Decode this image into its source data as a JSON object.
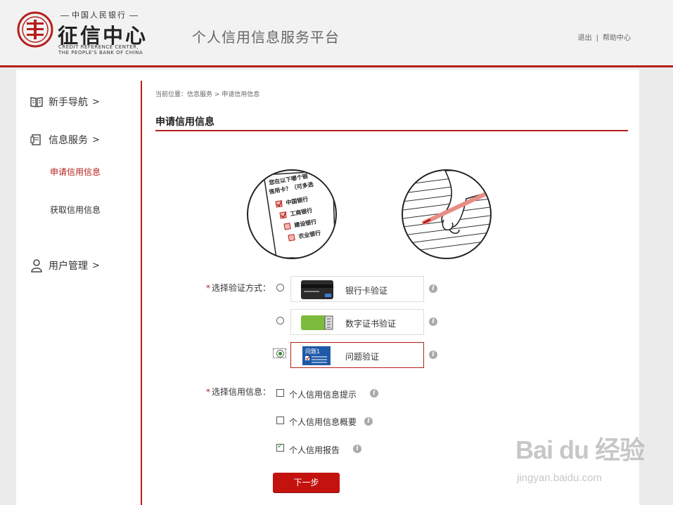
{
  "header": {
    "logo_cn_small": "中国人民银行",
    "logo_cn_big": "征信中心",
    "logo_en_line1": "CREDIT REFERENCE CENTER,",
    "logo_en_line2": "THE PEOPLE'S BANK OF CHINA",
    "platform_title": "个人信用信息服务平台",
    "logout_link": "退出",
    "link_separator": "|",
    "help_link": "帮助中心"
  },
  "sidebar": {
    "nav_guide": "新手导航",
    "nav_info_service": "信息服务",
    "sub_apply": "申请信用信息",
    "sub_get": "获取信用信息",
    "nav_user_mgmt": "用户管理",
    "arrow": ">"
  },
  "main": {
    "breadcrumb": "当前位置：信息服务 > 申请信用信息",
    "page_title": "申请信用信息",
    "illustration": {
      "line1": "您在以下哪个银",
      "line2": "信用卡？（可多选",
      "bank1": "中国银行",
      "bank2": "工商银行",
      "bank3": "建设银行",
      "bank4": "农业银行"
    },
    "verify_label": "选择验证方式：",
    "required_mark": "*",
    "verify_options": [
      {
        "label": "银行卡验证",
        "checked": false
      },
      {
        "label": "数字证书验证",
        "checked": false
      },
      {
        "label": "问题验证",
        "checked": true,
        "icon_text": "问题1"
      }
    ],
    "info_label": "选择信用信息：",
    "info_options": [
      {
        "label": "个人信用信息提示",
        "checked": false
      },
      {
        "label": "个人信用信息概要",
        "checked": false
      },
      {
        "label": "个人信用报告",
        "checked": true
      }
    ],
    "info_icon_glyph": "i",
    "next_button": "下一步"
  },
  "watermark": {
    "logo": "Bai du 经验",
    "url": "jingyan.baidu.com"
  },
  "colors": {
    "brand_red": "#b5201c",
    "button_red": "#c4120f",
    "check_green": "#2a8a2a"
  }
}
